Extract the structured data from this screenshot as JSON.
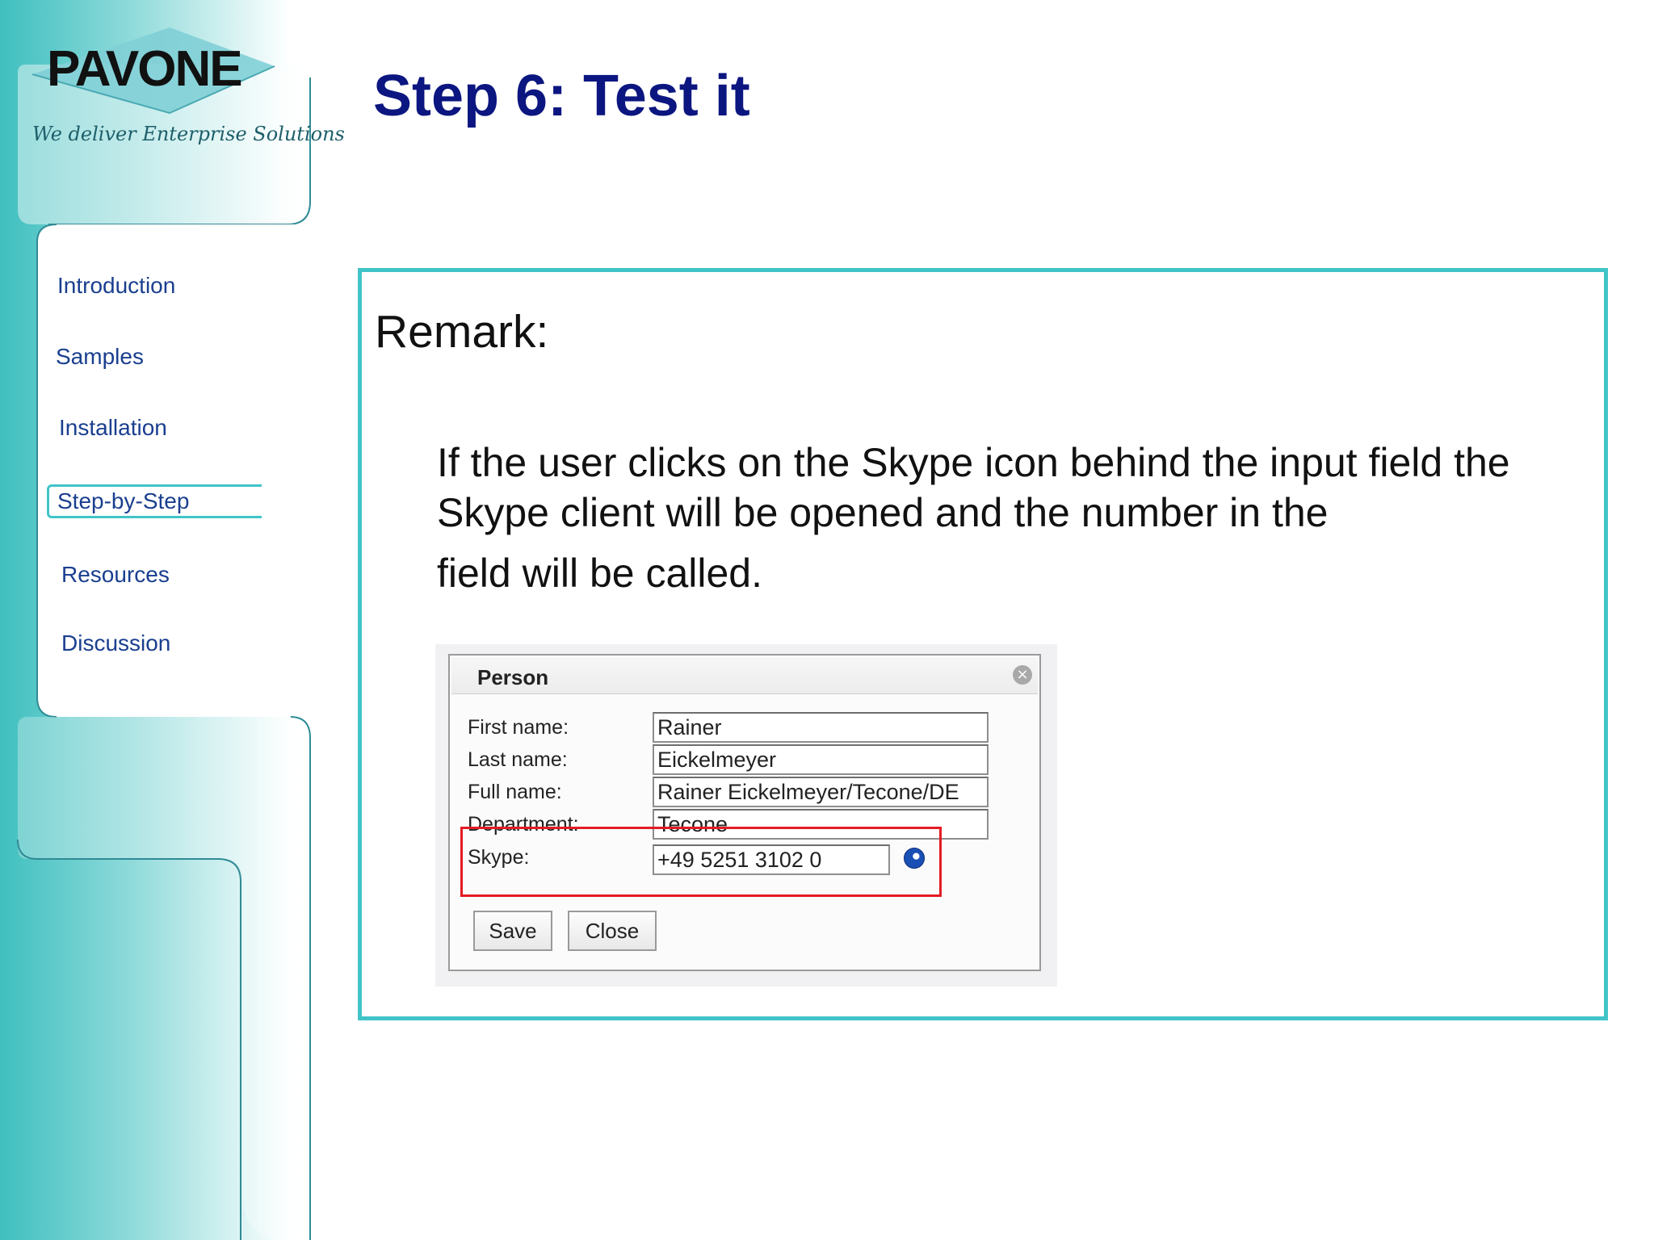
{
  "logo": {
    "word": "PAVONE",
    "tagline": "We deliver Enterprise Solutions"
  },
  "nav": {
    "items": [
      {
        "label": "Introduction"
      },
      {
        "label": "Samples"
      },
      {
        "label": "Installation"
      },
      {
        "label": "Step-by-Step",
        "active": true
      },
      {
        "label": "Resources"
      },
      {
        "label": "Discussion"
      }
    ]
  },
  "title": "Step 6: Test it",
  "content": {
    "heading": "Remark:",
    "lines": [
      "If the user clicks on the Skype icon behind the input field the",
      "Skype client will be opened and the number in the",
      "field will be called."
    ]
  },
  "dialog": {
    "title": "Person",
    "close_icon": "close-circle-icon",
    "fields": [
      {
        "label": "First name:",
        "value": "Rainer"
      },
      {
        "label": "Last name:",
        "value": "Eickelmeyer"
      },
      {
        "label": "Full name:",
        "value": "Rainer Eickelmeyer/Tecone/DE"
      },
      {
        "label": "Department:",
        "value": "Tecone"
      },
      {
        "label": "Skype:",
        "value": "+49 5251 3102 0"
      }
    ],
    "skype_icon": "skype-globe-icon",
    "buttons": {
      "save": "Save",
      "close": "Close"
    }
  },
  "colors": {
    "accent": "#40c4c8",
    "title": "#0c1680",
    "nav_text": "#1a3f8f",
    "highlight": "#e41b23"
  }
}
